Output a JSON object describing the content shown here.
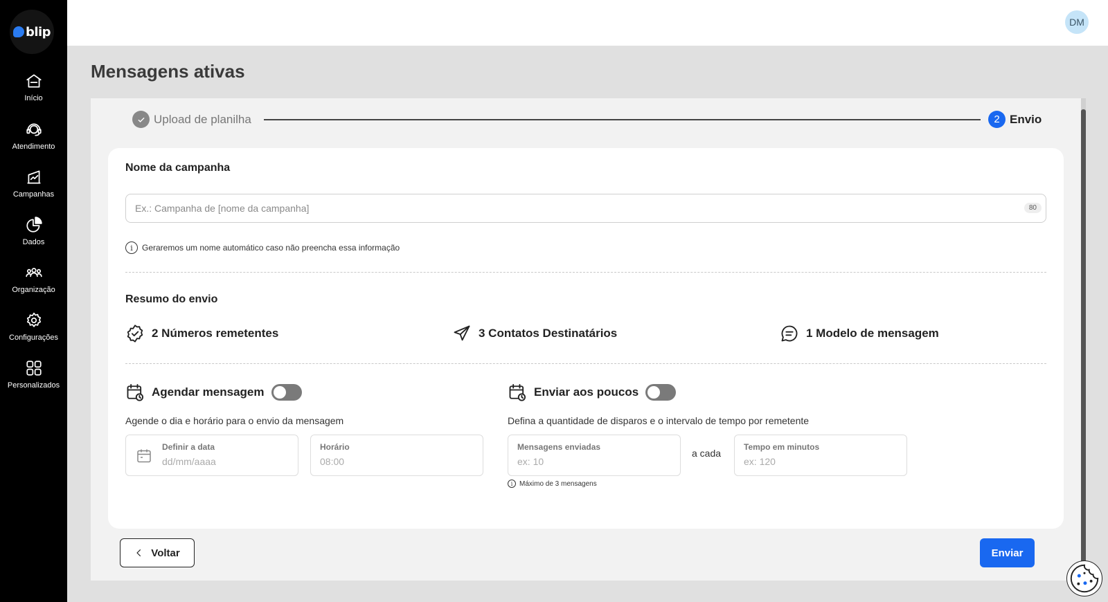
{
  "brand": {
    "logo_text": "blip",
    "accent": "#1968f0"
  },
  "sidebar": {
    "items": [
      {
        "label": "Início",
        "icon": "home-icon"
      },
      {
        "label": "Atendimento",
        "icon": "headset-icon"
      },
      {
        "label": "Campanhas",
        "icon": "campaign-icon"
      },
      {
        "label": "Dados",
        "icon": "pie-chart-icon"
      },
      {
        "label": "Organização",
        "icon": "people-icon"
      },
      {
        "label": "Configurações",
        "icon": "gear-icon"
      },
      {
        "label": "Personalizados",
        "icon": "grid-icon"
      }
    ]
  },
  "header": {
    "avatar_initials": "DM"
  },
  "page": {
    "title": "Mensagens ativas"
  },
  "stepper": {
    "step1": {
      "label": "Upload de planilha",
      "status": "done"
    },
    "step2": {
      "number": "2",
      "label": "Envio",
      "status": "active"
    }
  },
  "campaign_name": {
    "title": "Nome da campanha",
    "placeholder": "Ex.: Campanha de [nome da campanha]",
    "value": "",
    "counter": "80",
    "hint": "Geraremos um nome automático caso não preencha essa informação"
  },
  "summary": {
    "title": "Resumo do envio",
    "items": [
      {
        "text": "2 Números remetentes",
        "icon": "badge-check-icon"
      },
      {
        "text": "3 Contatos Destinatários",
        "icon": "send-icon"
      },
      {
        "text": "1 Modelo de mensagem",
        "icon": "message-icon"
      }
    ]
  },
  "schedule": {
    "title": "Agendar mensagem",
    "enabled": false,
    "description": "Agende o dia e horário para o envio da mensagem",
    "date_label": "Definir a data",
    "date_placeholder": "dd/mm/aaaa",
    "time_label": "Horário",
    "time_placeholder": "08:00"
  },
  "throttle": {
    "title": "Enviar aos poucos",
    "enabled": false,
    "description": "Defina a quantidade de disparos e o intervalo de tempo por remetente",
    "messages_label": "Mensagens enviadas",
    "messages_placeholder": "ex: 10",
    "separator": "a cada",
    "minutes_label": "Tempo em minutos",
    "minutes_placeholder": "ex: 120",
    "max_hint": "Máximo de 3 mensagens"
  },
  "actions": {
    "back_label": "Voltar",
    "send_label": "Enviar"
  }
}
